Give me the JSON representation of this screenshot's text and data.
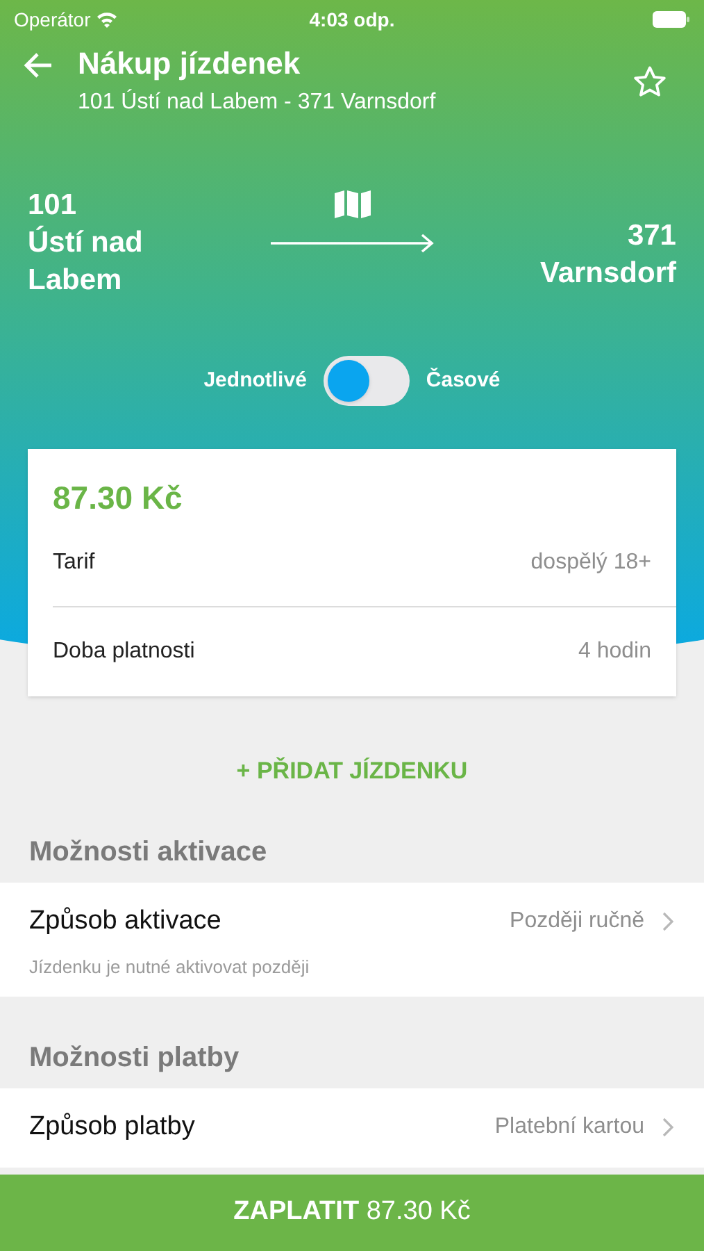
{
  "status_bar": {
    "carrier": "Operátor",
    "time": "4:03 odp."
  },
  "header": {
    "title": "Nákup jízdenek",
    "subtitle": "101 Ústí nad Labem - 371 Varnsdorf",
    "favorite": false
  },
  "route": {
    "from_number": "101",
    "from_name": "Ústí nad Labem",
    "to_number": "371",
    "to_name": "Varnsdorf"
  },
  "toggle": {
    "left_label": "Jednotlivé",
    "right_label": "Časové",
    "on": false
  },
  "ticket": {
    "price": "87.30 Kč",
    "rows": [
      {
        "label": "Tarif",
        "value": "dospělý 18+"
      },
      {
        "label": "Doba platnosti",
        "value": "4 hodin"
      }
    ]
  },
  "add_ticket": "+ PŘIDAT JÍZDENKU",
  "sections": [
    {
      "title": "Možnosti aktivace",
      "label": "Způsob aktivace",
      "value": "Později ručně",
      "note": "Jízdenku je nutné aktivovat později"
    },
    {
      "title": "Možnosti platby",
      "label": "Způsob platby",
      "value": "Platební kartou"
    }
  ],
  "pay_button": "**ZAPLATIT** 87.30 Kč"
}
